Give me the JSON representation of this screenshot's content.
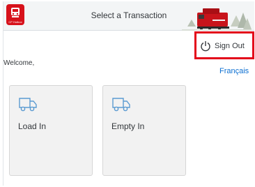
{
  "header": {
    "title": "Select a Transaction",
    "logo_text": "CP Hotbox",
    "logo_icon": "cp-logo-icon",
    "train_image": "locomotive-image"
  },
  "user": {
    "sign_out_label": "Sign Out",
    "sign_out_icon": "power-icon",
    "welcome_label": "Welcome,",
    "language_link": "Français"
  },
  "tiles": [
    {
      "label": "Load In",
      "icon": "truck-icon"
    },
    {
      "label": "Empty In",
      "icon": "truck-icon"
    }
  ],
  "colors": {
    "brand_red": "#d7121b",
    "highlight_red": "#e3061a",
    "link_blue": "#0a6ed1",
    "icon_blue": "#5b9bd1",
    "header_bg": "#f3f5f6",
    "tile_bg": "#f2f2f2"
  }
}
